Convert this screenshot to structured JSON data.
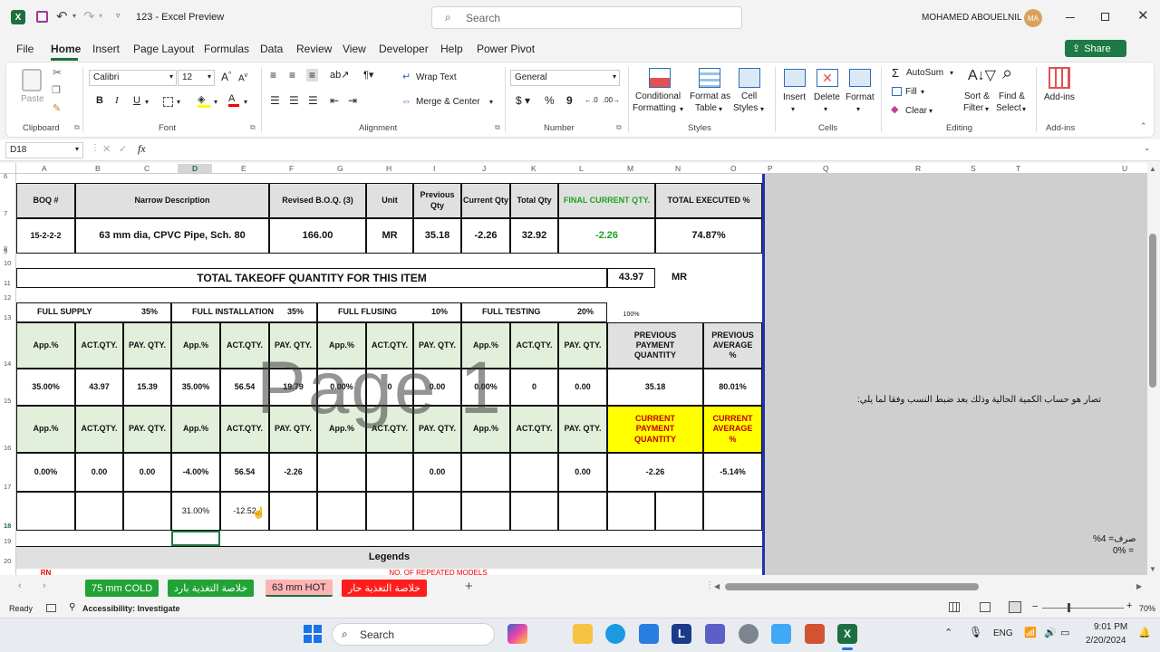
{
  "titlebar": {
    "filename": "123 - Excel Preview",
    "search_placeholder": "Search",
    "user": "MOHAMED ABOUELNIL",
    "avatar": "MA"
  },
  "menu_tabs": [
    "File",
    "Home",
    "Insert",
    "Page Layout",
    "Formulas",
    "Data",
    "Review",
    "View",
    "Developer",
    "Help",
    "Power Pivot"
  ],
  "share": "Share",
  "ribbon": {
    "clipboard": "Clipboard",
    "paste": "Paste",
    "font": "Font",
    "font_name": "Calibri",
    "font_size": "12",
    "alignment": "Alignment",
    "wrap": "Wrap Text",
    "merge": "Merge & Center",
    "number": "Number",
    "number_format": "General",
    "styles": "Styles",
    "cond1": "Conditional",
    "cond2": "Formatting",
    "fmt1": "Format as",
    "fmt2": "Table",
    "cell1": "Cell",
    "cell2": "Styles",
    "cells": "Cells",
    "insert": "Insert",
    "delete": "Delete",
    "format": "Format",
    "editing": "Editing",
    "autosum": "AutoSum",
    "fill": "Fill",
    "clear": "Clear",
    "sort1": "Sort &",
    "sort2": "Filter",
    "find1": "Find &",
    "find2": "Select",
    "addins": "Add-ins",
    "addins_btn": "Add-ins"
  },
  "namebox": "D18",
  "fx": "fx",
  "columns": [
    "A",
    "B",
    "C",
    "D",
    "E",
    "F",
    "G",
    "H",
    "I",
    "J",
    "K",
    "L",
    "M",
    "N",
    "O",
    "P",
    "Q",
    "R",
    "S",
    "T",
    "U"
  ],
  "rows": [
    "6",
    "7",
    "8",
    "9",
    "10",
    "11",
    "12",
    "13",
    "14",
    "15",
    "16",
    "17",
    "18",
    "19",
    "20"
  ],
  "sheet": {
    "hdr": {
      "boq": "BOQ #",
      "desc": "Narrow Description",
      "revised": "Revised B.O.Q. (3)",
      "unit": "Unit",
      "prev": "Previous Qty",
      "curr": "Current Qty",
      "total": "Total Qty",
      "final": "FINAL CURRENT QTY.",
      "executed": "TOTAL EXECUTED %"
    },
    "row8": {
      "boq": "15-2-2-2",
      "desc": "63 mm dia, CPVC Pipe, Sch. 80",
      "revised": "166.00",
      "unit": "MR",
      "prev": "35.18",
      "curr": "-2.26",
      "total": "32.92",
      "final": "-2.26",
      "executed": "74.87%"
    },
    "takeoff": {
      "label": "TOTAL TAKEOFF QUANTITY FOR THIS ITEM",
      "qty": "43.97",
      "unit": "MR"
    },
    "sections": [
      {
        "name": "FULL SUPPLY",
        "pct": "35%"
      },
      {
        "name": "FULL INSTALLATION",
        "pct": "35%"
      },
      {
        "name": "FULL FLUSING",
        "pct": "10%"
      },
      {
        "name": "FULL TESTING",
        "pct": "20%"
      }
    ],
    "pct100": "100%",
    "sub": {
      "app": "App.%",
      "act": "ACT.QTY.",
      "pay": "PAY. QTY."
    },
    "prev_payment": "PREVIOUS PAYMENT QUANTITY",
    "prev_avg": "PREVIOUS AVERAGE %",
    "row14": [
      "35.00%",
      "43.97",
      "15.39",
      "35.00%",
      "56.54",
      "19.79",
      "0.00%",
      "0",
      "0.00",
      "0.00%",
      "0",
      "0.00",
      "35.18",
      "80.01%"
    ],
    "curr_payment": "CURRENT PAYMENT QUANTITY",
    "curr_avg": "CURRENT AVERAGE %",
    "row16": [
      "0.00%",
      "0.00",
      "0.00",
      "-4.00%",
      "56.54",
      "-2.26",
      "",
      "",
      "0.00",
      "",
      "",
      "0.00",
      "-2.26",
      "-5.14%"
    ],
    "row17": {
      "d": "31.00%",
      "e": "-12.52"
    },
    "legends": "Legends",
    "row20a": "RN",
    "row20b": "NO. OF REPEATED MODELS",
    "watermark": "Page 1"
  },
  "side_text": {
    "arabic": "تصار هو حساب الكمية الحالية وذلك بعد ضبط النسب وفقا لما يلي:",
    "p1": "صرف= 4%",
    "p2": "= 0%"
  },
  "sheet_tabs": [
    {
      "label": "75 mm COLD",
      "color": "#21a336"
    },
    {
      "label": "خلاصة التغذية بارد",
      "color": "#21a336"
    },
    {
      "label": "63 mm HOT",
      "color": "#ff3b3b"
    },
    {
      "label": "خلاصة التغذية حار",
      "color": "#ff1c1c"
    }
  ],
  "status": {
    "ready": "Ready",
    "accessibility": "Accessibility: Investigate",
    "zoom": "70%"
  },
  "taskbar": {
    "search": "Search",
    "lang": "ENG",
    "time": "9:01 PM",
    "date": "2/20/2024"
  }
}
